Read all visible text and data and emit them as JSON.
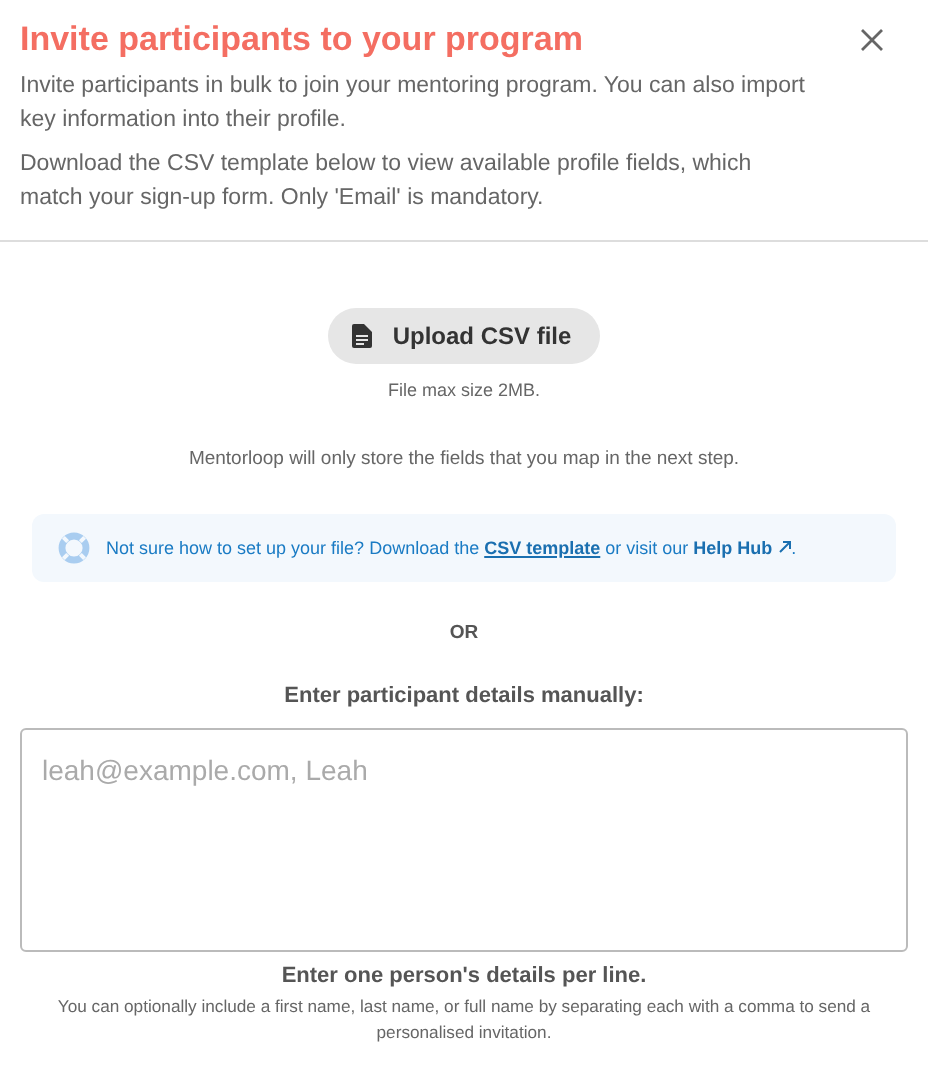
{
  "dialog": {
    "title": "Invite participants to your program"
  },
  "intro": [
    "Invite participants in bulk to join your mentoring program. You can also import key information into their profile.",
    "Download the CSV template below to view available profile fields, which match your sign-up form. Only 'Email' is mandatory."
  ],
  "upload": {
    "button": "Upload CSV file",
    "size_note": "File max size 2MB.",
    "storage_note": "Mentorloop will only store the fields that you map in the next step."
  },
  "help": {
    "before": "Not sure how to set up your file?  Download the ",
    "template_link": "CSV template",
    "middle": " or visit our ",
    "hub_link": "Help Hub",
    "after": "."
  },
  "separator": "OR",
  "manual": {
    "label": "Enter participant details manually:",
    "placeholder": "leah@example.com, Leah",
    "hint_title": "Enter one person's details per line.",
    "hint": "You can optionally include a first name, last name, or full name by separating each with a comma to send a personalised invitation."
  }
}
